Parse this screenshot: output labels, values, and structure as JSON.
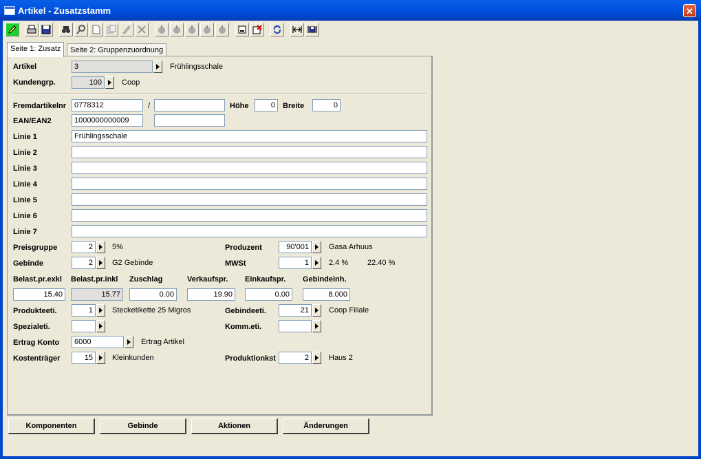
{
  "window": {
    "title": "Artikel - Zusatzstamm",
    "close_label": "✕"
  },
  "toolbar": {
    "icons": [
      "pencil-icon",
      "printer-icon",
      "save-icon",
      "binoculars-icon",
      "search-icon",
      "new-document-icon",
      "copy-icon",
      "edit-icon",
      "delete-icon",
      "action1-icon",
      "action2-icon",
      "action3-icon",
      "action4-icon",
      "action5-icon",
      "minimize-doc-icon",
      "delete-doc-icon",
      "refresh-icon",
      "expand-width-icon",
      "save-width-icon"
    ]
  },
  "tabs": [
    {
      "label": "Seite 1: Zusatz"
    },
    {
      "label": "Seite 2: Gruppenzuordnung"
    }
  ],
  "form": {
    "artikel": {
      "label": "Artikel",
      "value": "3",
      "desc": "Frühlingsschale"
    },
    "kundengrp": {
      "label": "Kundengrp.",
      "value": "100",
      "desc": "Coop"
    },
    "fremdartikel": {
      "label": "Fremdartikelnr",
      "value1": "0778312",
      "slash": "/",
      "value2": ""
    },
    "hoehe": {
      "label": "Höhe",
      "value": "0"
    },
    "breite": {
      "label": "Breite",
      "value": "0"
    },
    "ean": {
      "label": "EAN/EAN2",
      "value1": "1000000000009",
      "value2": ""
    },
    "linien": [
      {
        "label": "Linie 1",
        "value": "Frühlingsschale"
      },
      {
        "label": "Linie 2",
        "value": ""
      },
      {
        "label": "Linie 3",
        "value": ""
      },
      {
        "label": "Linie 4",
        "value": ""
      },
      {
        "label": "Linie 5",
        "value": ""
      },
      {
        "label": "Linie 6",
        "value": ""
      },
      {
        "label": "Linie 7",
        "value": ""
      }
    ],
    "preisgruppe": {
      "label": "Preisgruppe",
      "value": "2",
      "desc": "5%"
    },
    "produzent": {
      "label": "Produzent",
      "value": "90'001",
      "desc": "Gasa Arhuus"
    },
    "gebinde": {
      "label": "Gebinde",
      "value": "2",
      "desc": "G2 Gebinde"
    },
    "mwst": {
      "label": "MWSt",
      "value": "1",
      "desc": "2.4 %",
      "desc2": "22.40 %"
    },
    "prices": {
      "headers": [
        "Belast.pr.exkl",
        "Belast.pr.inkl",
        "Zuschlag",
        "Verkaufspr.",
        "Einkaufspr.",
        "Gebindeinh."
      ],
      "values": [
        "15.40",
        "15.77",
        "0.00",
        "19.90",
        "0.00",
        "8.000"
      ]
    },
    "produkteeti": {
      "label": "Produkteeti.",
      "value": "1",
      "desc": "Stecketikette 25 Migros"
    },
    "gebindeeti": {
      "label": "Gebindeeti.",
      "value": "21",
      "desc": "Coop Filiale"
    },
    "spezialeti": {
      "label": "Spezialeti.",
      "value": ""
    },
    "kommeti": {
      "label": "Komm.eti.",
      "value": ""
    },
    "ertrag": {
      "label": "Ertrag Konto",
      "value": "6000",
      "desc": "Ertrag Artikel"
    },
    "kostentraeger": {
      "label": "Kostenträger",
      "value": "15",
      "desc": "Kleinkunden"
    },
    "produktionskst": {
      "label": "Produktionkst",
      "value": "2",
      "desc": "Haus 2"
    }
  },
  "buttons": {
    "komponenten": "Komponenten",
    "gebinde": "Gebinde",
    "aktionen": "Aktionen",
    "aenderungen": "Änderungen"
  },
  "colors": {
    "titlebar": "#0054e3",
    "window_bg": "#ece9d8",
    "active_tool": "#1dd12c"
  }
}
